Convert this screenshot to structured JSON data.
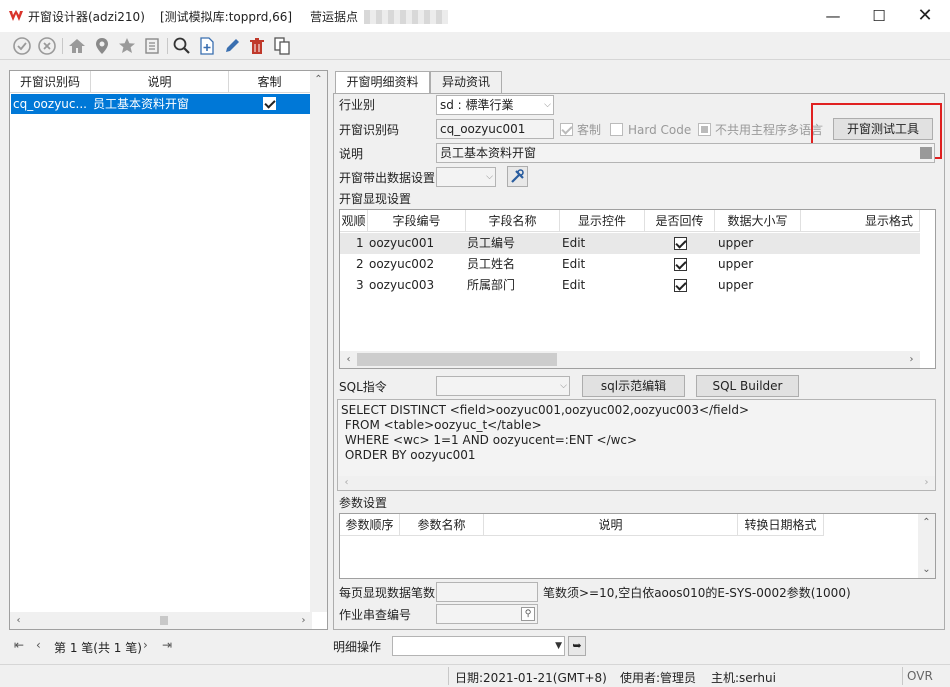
{
  "window": {
    "title": "开窗设计器(adzi210)",
    "db": "[测试模拟库:topprd,66]",
    "site_label": "营运据点",
    "colors": {
      "accent": "#0078d7",
      "highlight_box": "#e02020",
      "brand": "#d9342b"
    }
  },
  "toolbar": {
    "icons": [
      "check-icon",
      "cancel-icon",
      "home-icon",
      "location-pin-icon",
      "star-icon",
      "list-icon",
      "search-icon",
      "add-icon",
      "edit-icon",
      "delete-icon",
      "copy-icon"
    ]
  },
  "left_grid": {
    "headers": [
      "开窗识别码",
      "说明",
      "客制"
    ],
    "rows": [
      {
        "code": "cq_oozyuc...",
        "desc": "员工基本资料开窗",
        "custom": true
      }
    ]
  },
  "pager": {
    "text": "第 1 笔(共 1 笔)"
  },
  "tabs": [
    "开窗明细资料",
    "异动资讯"
  ],
  "form": {
    "industry_label": "行业别",
    "industry_value": "sd : 標準行業",
    "code_label": "开窗识别码",
    "code_value": "cq_oozyuc001",
    "custom_label": "客制",
    "hardcode_label": "Hard Code",
    "no_multilang_label": "不共用主程序多语言",
    "test_tool_button": "开窗测试工具",
    "desc_label": "说明",
    "desc_value": "员工基本资料开窗",
    "output_label": "开窗带出数据设置",
    "display_label": "开窗显现设置"
  },
  "display_grid": {
    "headers": [
      "观顺",
      "字段编号",
      "字段名称",
      "显示控件",
      "是否回传",
      "数据大小写",
      "显示格式"
    ],
    "rows": [
      {
        "seq": "1",
        "field": "oozyuc001",
        "name": "员工编号",
        "control": "Edit",
        "ret": true,
        "case": "upper"
      },
      {
        "seq": "2",
        "field": "oozyuc002",
        "name": "员工姓名",
        "control": "Edit",
        "ret": true,
        "case": "upper"
      },
      {
        "seq": "3",
        "field": "oozyuc003",
        "name": "所属部门",
        "control": "Edit",
        "ret": true,
        "case": "upper"
      }
    ]
  },
  "sql": {
    "label": "SQL指令",
    "sample_button": "sql示范编辑",
    "builder_button": "SQL Builder",
    "lines": [
      "SELECT DISTINCT <field>oozyuc001,oozyuc002,oozyuc003</field>",
      " FROM <table>oozyuc_t</table>",
      " WHERE <wc> 1=1 AND oozyucent=:ENT </wc>",
      " ORDER BY oozyuc001"
    ]
  },
  "params": {
    "label": "参数设置",
    "headers": [
      "参数顺序",
      "参数名称",
      "说明",
      "转换日期格式"
    ]
  },
  "paging": {
    "per_page_label": "每页显现数据笔数",
    "per_page_note": "笔数须>=10,空白依aoos010的E-SYS-0002参数(1000)",
    "job_label": "作业串查编号"
  },
  "detail_op": {
    "label": "明细操作"
  },
  "status": {
    "date": "日期:2021-01-21(GMT+8)",
    "user": "使用者:管理员",
    "host": "主机:serhui",
    "mode": "OVR"
  }
}
